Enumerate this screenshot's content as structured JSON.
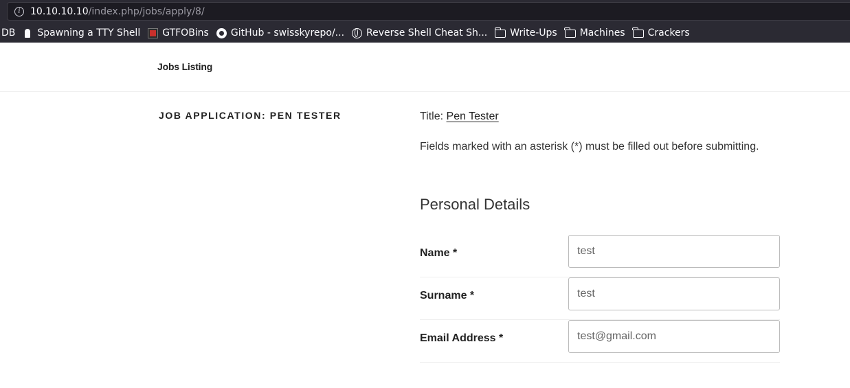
{
  "browser": {
    "url_host": "10.10.10.10",
    "url_path": "/index.php/jobs/apply/8/",
    "bookmarks": [
      {
        "label": "DB",
        "icon": "none"
      },
      {
        "label": "Spawning a TTY Shell",
        "icon": "ghost-icon"
      },
      {
        "label": "GTFOBins",
        "icon": "gtfobins-icon"
      },
      {
        "label": "GitHub - swisskyrepo/...",
        "icon": "github-icon"
      },
      {
        "label": "Reverse Shell Cheat Sh...",
        "icon": "globe-icon"
      },
      {
        "label": "Write-Ups",
        "icon": "folder-icon"
      },
      {
        "label": "Machines",
        "icon": "folder-icon"
      },
      {
        "label": "Crackers",
        "icon": "folder-icon"
      }
    ]
  },
  "site": {
    "nav_label": "Jobs Listing"
  },
  "page": {
    "heading": "JOB APPLICATION: PEN TESTER",
    "title_prefix": "Title:",
    "title_link": "Pen Tester",
    "notice": "Fields marked with an asterisk (*) must be filled out before submitting.",
    "section_title": "Personal Details"
  },
  "form": {
    "fields": [
      {
        "label": "Name *",
        "value": "test"
      },
      {
        "label": "Surname *",
        "value": "test"
      },
      {
        "label": "Email Address *",
        "value": "test@gmail.com"
      }
    ]
  }
}
